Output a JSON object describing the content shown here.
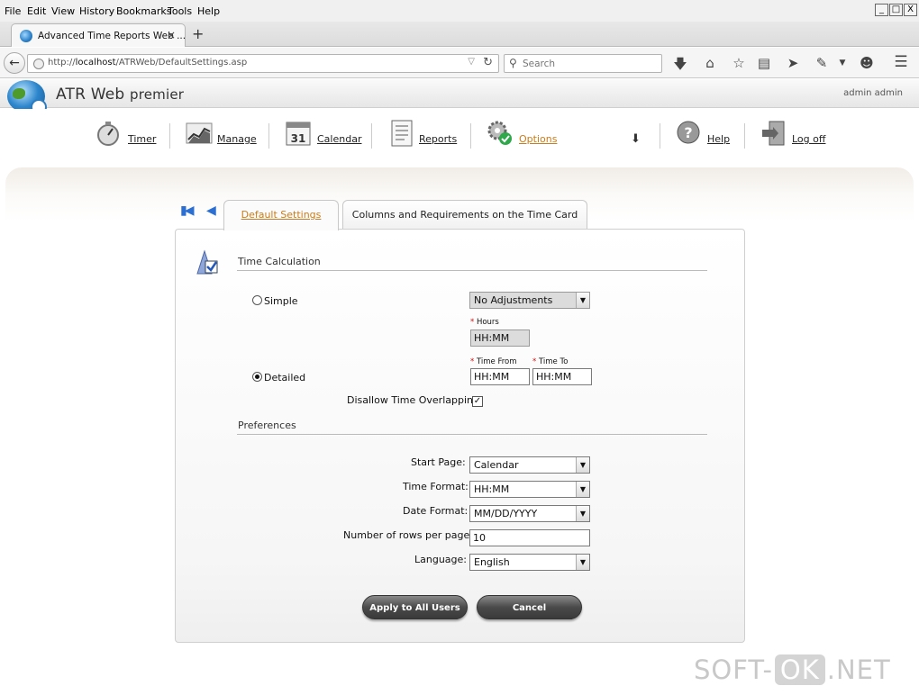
{
  "browser": {
    "menu": [
      "File",
      "Edit",
      "View",
      "History",
      "Bookmarks",
      "Tools",
      "Help"
    ],
    "menu_underline": [
      "F",
      "E",
      "V",
      "H",
      "B",
      "T",
      "H"
    ],
    "window_controls": [
      "_",
      "□",
      "X"
    ],
    "tab_title": "Advanced Time Reports Web ...",
    "tab_close": "×",
    "new_tab": "+",
    "url_prefix": "http://",
    "url_host": "localhost",
    "url_path": "/ATRWeb/DefaultSettings.asp",
    "search_placeholder": "Search",
    "toolbar_icons": [
      "download-icon",
      "home-icon",
      "bookmark-star-icon",
      "reading-list-icon",
      "send-icon",
      "pocket-icon",
      "chat-icon",
      "hamburger-menu-icon"
    ]
  },
  "app": {
    "title": "ATR Web",
    "title_suffix": "premier",
    "user": "admin admin"
  },
  "nav": {
    "timer": "Timer",
    "manage": "Manage",
    "calendar": "Calendar",
    "calendar_day": "31",
    "reports": "Reports",
    "options": "Options",
    "help": "Help",
    "logoff": "Log off"
  },
  "tabs": {
    "default_settings": "Default Settings",
    "columns": "Columns and Requirements on the Time Card"
  },
  "time_calc": {
    "section_title": "Time Calculation",
    "simple_label": "Simple",
    "simple_select": "No Adjustments",
    "hours_label": "Hours",
    "hours_value": "HH:MM",
    "detailed_label": "Detailed",
    "time_from_label": "Time From",
    "time_from_value": "HH:MM",
    "time_to_label": "Time To",
    "time_to_value": "HH:MM",
    "overlap_label": "Disallow Time Overlapping",
    "overlap_checked": "✓",
    "required_mark": "*"
  },
  "preferences": {
    "section_title": "Preferences",
    "start_page_label": "Start Page:",
    "start_page_value": "Calendar",
    "time_format_label": "Time Format:",
    "time_format_value": "HH:MM",
    "date_format_label": "Date Format:",
    "date_format_value": "MM/DD/YYYY",
    "rows_label": "Number of rows per page:",
    "rows_value": "10",
    "language_label": "Language:",
    "language_value": "English"
  },
  "actions": {
    "apply": "Apply to All Users",
    "cancel": "Cancel"
  },
  "watermark": {
    "left": "SOFT-",
    "box": "OK",
    "right": ".NET"
  },
  "colors": {
    "accent_orange": "#c87d1e",
    "pager_blue": "#2c6fd2",
    "required_red": "#d01010"
  }
}
